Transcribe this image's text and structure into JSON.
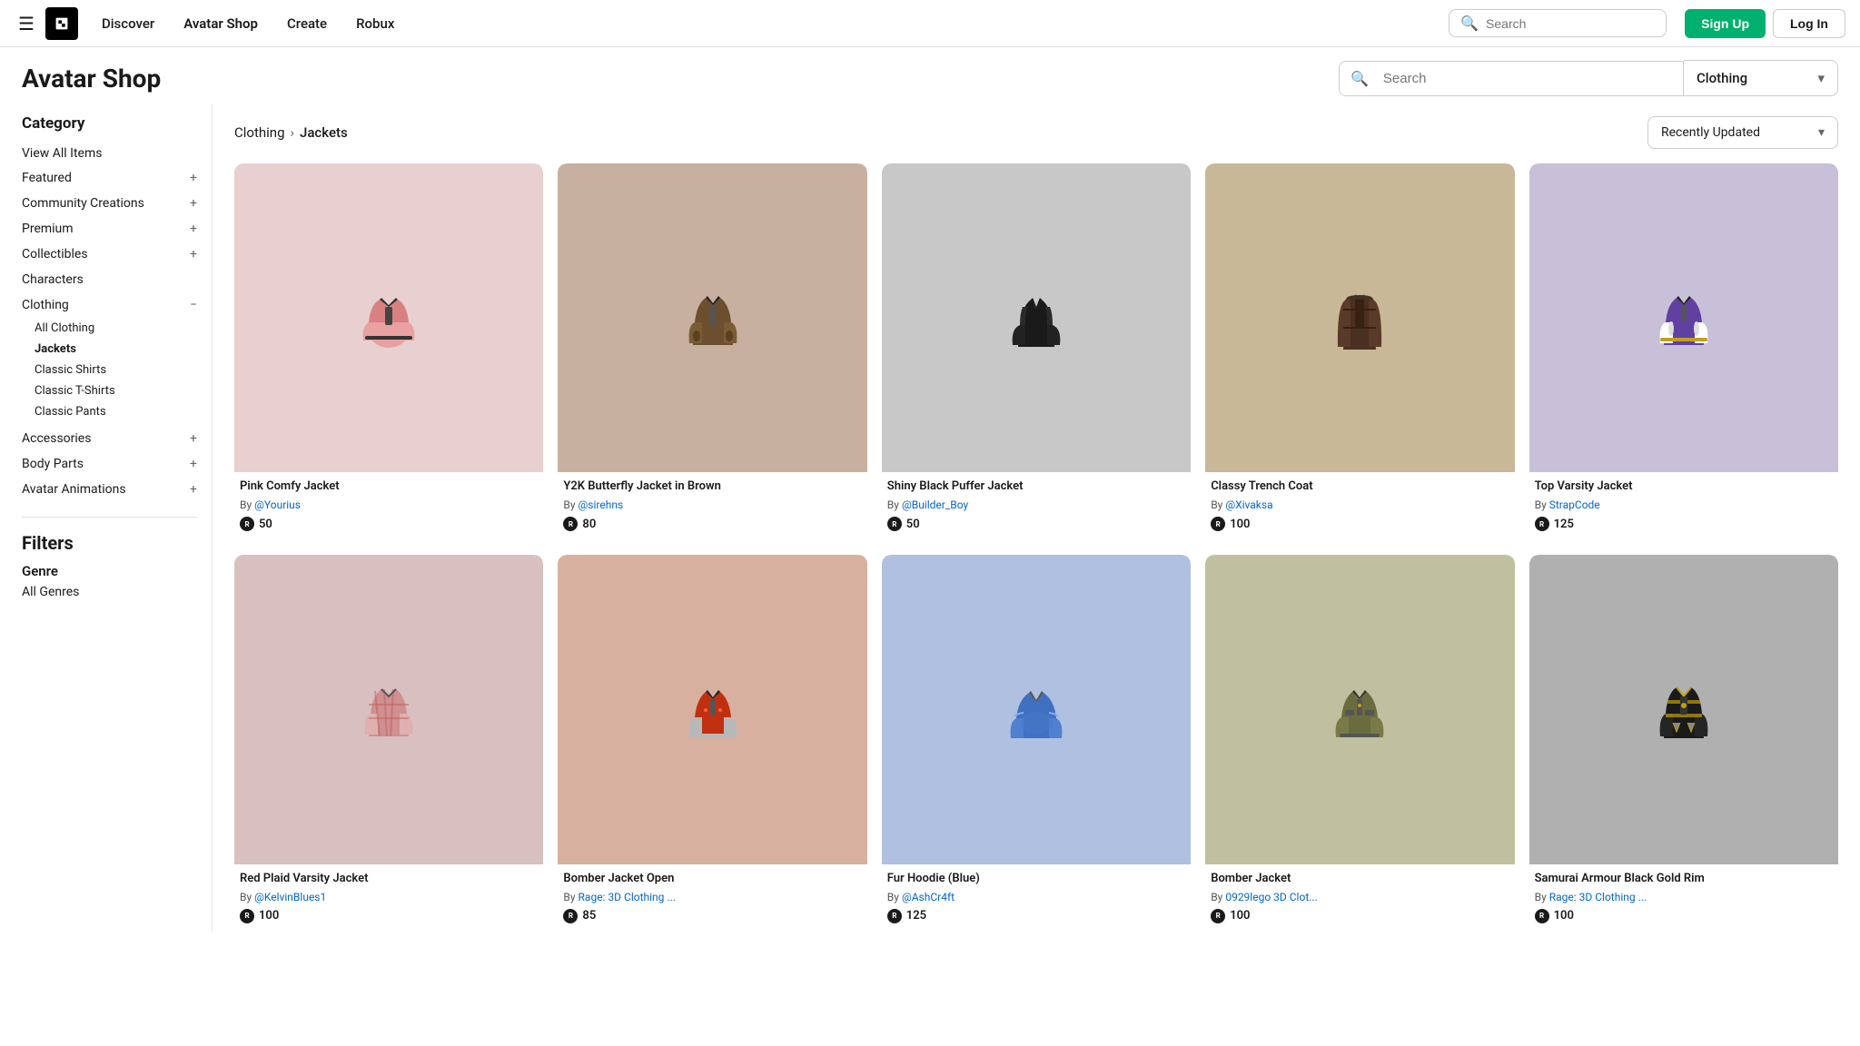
{
  "topnav": {
    "hamburger_label": "☰",
    "logo_alt": "Roblox",
    "links": [
      {
        "id": "discover",
        "label": "Discover"
      },
      {
        "id": "avatar-shop",
        "label": "Avatar Shop",
        "active": true
      },
      {
        "id": "create",
        "label": "Create"
      },
      {
        "id": "robux",
        "label": "Robux"
      }
    ],
    "search_placeholder": "Search",
    "signup_label": "Sign Up",
    "login_label": "Log In"
  },
  "shop": {
    "title": "Avatar Shop",
    "search_placeholder": "Search",
    "category_label": "Clothing",
    "category_chevron": "▾"
  },
  "sidebar": {
    "category_title": "Category",
    "view_all_label": "View All Items",
    "items": [
      {
        "id": "featured",
        "label": "Featured",
        "expandable": true,
        "icon": "+"
      },
      {
        "id": "community",
        "label": "Community Creations",
        "expandable": true,
        "icon": "+"
      },
      {
        "id": "premium",
        "label": "Premium",
        "expandable": true,
        "icon": "+"
      },
      {
        "id": "collectibles",
        "label": "Collectibles",
        "expandable": true,
        "icon": "+"
      },
      {
        "id": "characters",
        "label": "Characters",
        "expandable": false
      },
      {
        "id": "clothing",
        "label": "Clothing",
        "expandable": true,
        "icon": "−",
        "expanded": true
      }
    ],
    "clothing_sub": [
      {
        "id": "all-clothing",
        "label": "All Clothing"
      },
      {
        "id": "jackets",
        "label": "Jackets",
        "active": true
      },
      {
        "id": "classic-shirts",
        "label": "Classic Shirts"
      },
      {
        "id": "classic-tshirts",
        "label": "Classic T-Shirts"
      },
      {
        "id": "classic-pants",
        "label": "Classic Pants"
      }
    ],
    "accessories": {
      "label": "Accessories",
      "icon": "+"
    },
    "body_parts": {
      "label": "Body Parts",
      "icon": "+"
    },
    "avatar_animations": {
      "label": "Avatar Animations",
      "icon": "+"
    },
    "filters_title": "Filters",
    "genre_title": "Genre",
    "all_genres_label": "All Genres"
  },
  "content": {
    "breadcrumb": {
      "parent": "Clothing",
      "separator": "›",
      "current": "Jackets"
    },
    "sort_label": "Recently Updated",
    "sort_chevron": "▾",
    "items": [
      {
        "id": "pink-comfy",
        "name": "Pink Comfy Jacket",
        "creator": "@Yourius",
        "price": 50,
        "color_class": "jacket-pink",
        "emoji": "🧥"
      },
      {
        "id": "y2k-butterfly",
        "name": "Y2K Butterfly Jacket in Brown",
        "creator": "@sirehns",
        "price": 80,
        "color_class": "jacket-brown",
        "emoji": "🧥"
      },
      {
        "id": "shiny-black",
        "name": "Shiny Black Puffer Jacket",
        "creator": "@Builder_Boy",
        "price": 50,
        "color_class": "jacket-black",
        "emoji": "🧥"
      },
      {
        "id": "classy-trench",
        "name": "Classy Trench Coat",
        "creator": "@Xivaksa",
        "price": 100,
        "color_class": "jacket-trench",
        "emoji": "🧥"
      },
      {
        "id": "top-varsity",
        "name": "Top Varsity Jacket",
        "creator": "StrapCode",
        "price": 125,
        "color_class": "jacket-varsity",
        "emoji": "🧥"
      },
      {
        "id": "red-plaid",
        "name": "Red Plaid Varsity Jacket",
        "creator": "@KelvinBlues1",
        "price": 100,
        "color_class": "jacket-red-plaid",
        "emoji": "🧥"
      },
      {
        "id": "bomber-open",
        "name": "Bomber Jacket Open",
        "creator": "Rage: 3D Clothing ...",
        "price": 85,
        "color_class": "jacket-bomber-red",
        "emoji": "🧥"
      },
      {
        "id": "fur-hoodie-blue",
        "name": "Fur Hoodie (Blue)",
        "creator": "@AshCr4ft",
        "price": 125,
        "color_class": "jacket-blue",
        "emoji": "🧥"
      },
      {
        "id": "bomber-olive",
        "name": "Bomber Jacket",
        "creator": "0929lego 3D Clot...",
        "price": 100,
        "color_class": "jacket-olive",
        "emoji": "🧥"
      },
      {
        "id": "samurai-armour",
        "name": "Samurai Armour Black Gold Rim",
        "creator": "Rage: 3D Clothing ...",
        "price": 100,
        "color_class": "jacket-samurai",
        "emoji": "🧥"
      }
    ]
  }
}
